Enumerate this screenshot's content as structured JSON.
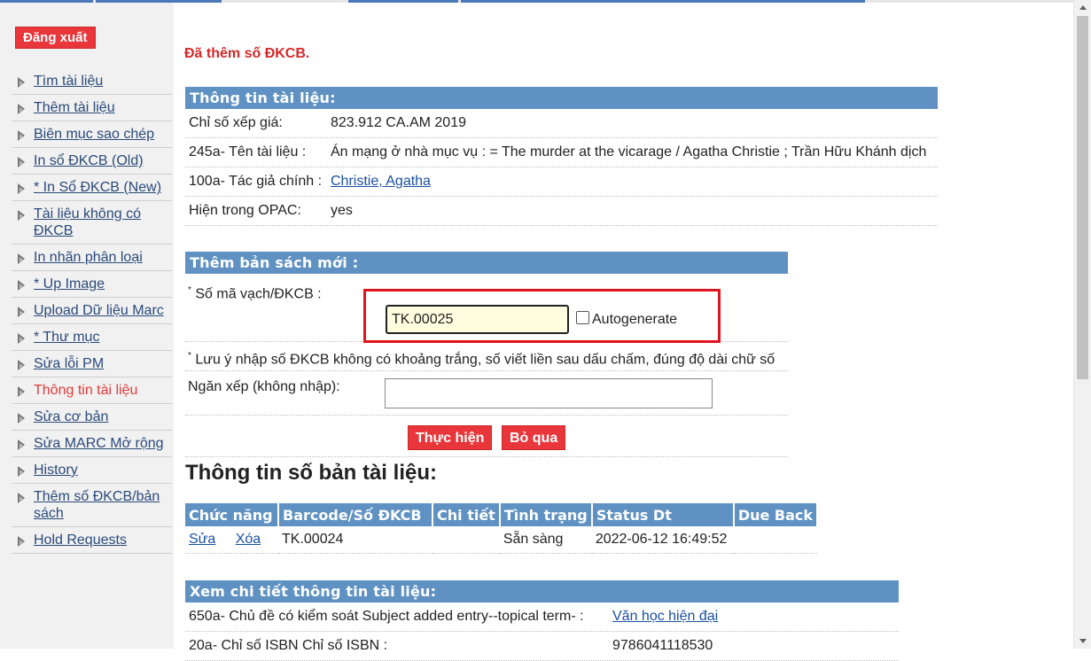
{
  "sidebar": {
    "logout_label": "Đăng xuất",
    "items": [
      {
        "label": "Tìm tài liệu"
      },
      {
        "label": "Thêm tài liệu"
      },
      {
        "label": "Biên mục sao chép"
      },
      {
        "label": "In sổ ĐKCB (Old)"
      },
      {
        "label": "* In Sổ ĐKCB (New)"
      },
      {
        "label": "Tài liệu không có ĐKCB"
      },
      {
        "label": "In nhãn phân loại"
      },
      {
        "label": "* Up Image"
      },
      {
        "label": "Upload Dữ liệu Marc"
      },
      {
        "label": "* Thư mục"
      },
      {
        "label": "Sửa lỗi PM"
      },
      {
        "label": "Thông tin tài liệu"
      },
      {
        "label": "Sửa cơ bản"
      },
      {
        "label": "Sửa MARC Mở rộng"
      },
      {
        "label": "History"
      },
      {
        "label": "Thêm số ĐKCB/bản sách"
      },
      {
        "label": "Hold Requests"
      }
    ]
  },
  "main": {
    "message": "Đã thêm số ĐKCB.",
    "info": {
      "header": "Thông tin tài liệu:",
      "call_number_label": "Chỉ số xếp giá:",
      "call_number": "823.912 CA.AM 2019",
      "title_label": "245a- Tên tài liệu :",
      "title": "Án mạng ở nhà mục vụ : = The murder at the vicarage / Agatha Christie ; Trần Hữu Khánh dịch",
      "author_label": "100a- Tác giả chính :",
      "author": "Christie, Agatha",
      "opac_label": "Hiện trong OPAC:",
      "opac": "yes"
    },
    "add_copy": {
      "header": "Thêm bản sách mới :",
      "required_mark": "*",
      "barcode_label": " Số mã vạch/ĐKCB :",
      "barcode_value": "TK.00025",
      "autogenerate_label": "Autogenerate",
      "note_mark": "*",
      "note": " Lưu ý nhập số ĐKCB không có khoảng trắng, số viết liền sau dấu chấm, đúng độ dài chữ số",
      "shelf_label": "Ngăn xếp (không nhập):",
      "shelf_value": "",
      "submit_label": "Thực hiện",
      "skip_label": "Bỏ qua"
    },
    "copies": {
      "title": "Thông tin số bản tài liệu:",
      "headers": [
        "Chức năng",
        "Barcode/Số ĐKCB",
        "Chi tiết",
        "Tình trạng",
        "Status Dt",
        "Due Back"
      ],
      "rows": [
        {
          "edit": "Sửa",
          "delete": "Xóa",
          "barcode": "TK.00024",
          "detail": "",
          "status": "Sẵn sàng",
          "status_dt": "2022-06-12 16:49:52",
          "due_back": ""
        }
      ]
    },
    "detail": {
      "header": "Xem chi tiết thông tin tài liệu:",
      "rows": [
        {
          "label": "650a- Chủ đề có kiểm soát Subject added entry--topical term- :",
          "value": "Văn học hiện đại"
        },
        {
          "label": "20a- Chỉ số ISBN Chỉ số ISBN :",
          "value": "9786041118530"
        }
      ]
    }
  }
}
